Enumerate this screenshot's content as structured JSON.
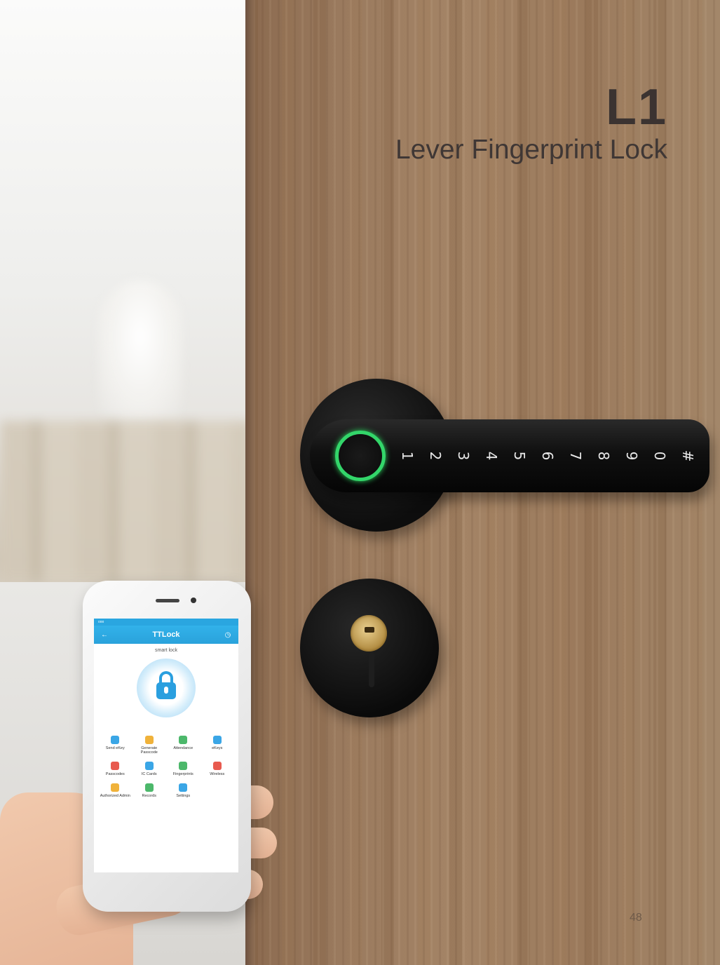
{
  "header": {
    "model": "L1",
    "subtitle": "Lever Fingerprint Lock"
  },
  "page_number": "48",
  "lock": {
    "keypad": [
      "1",
      "2",
      "3",
      "4",
      "5",
      "6",
      "7",
      "8",
      "9",
      "0",
      "#"
    ],
    "sensor_color": "#33d66a"
  },
  "phone": {
    "status_left": "ooo",
    "status_mid": "",
    "status_right": "",
    "app_title": "TTLock",
    "lock_name": "smart lock",
    "features": [
      {
        "label": "Send eKey",
        "color": "#3aa6e6"
      },
      {
        "label": "Generate Passcode",
        "color": "#f0b23a"
      },
      {
        "label": "Attendance",
        "color": "#4cb86b"
      },
      {
        "label": "eKeys",
        "color": "#3aa6e6"
      },
      {
        "label": "Passcodes",
        "color": "#e85a4f"
      },
      {
        "label": "IC Cards",
        "color": "#3aa6e6"
      },
      {
        "label": "Fingerprints",
        "color": "#4cb86b"
      },
      {
        "label": "Wireless",
        "color": "#e85a4f"
      },
      {
        "label": "Authorized Admin",
        "color": "#f0b23a"
      },
      {
        "label": "Records",
        "color": "#4cb86b"
      },
      {
        "label": "Settings",
        "color": "#3aa6e6"
      }
    ]
  }
}
